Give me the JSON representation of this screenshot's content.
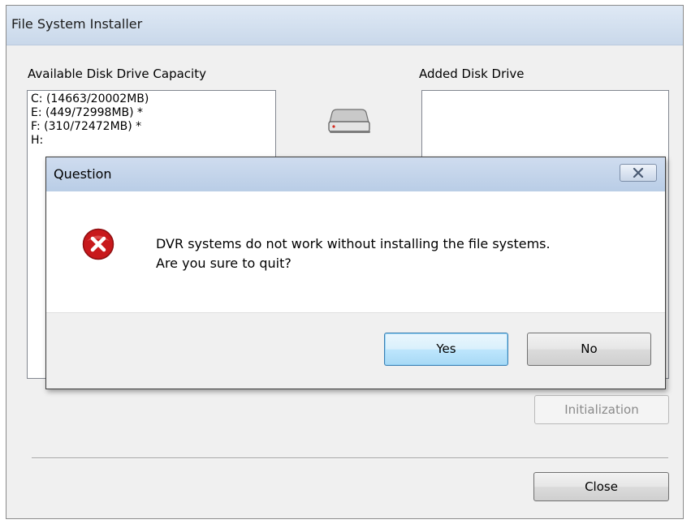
{
  "window": {
    "title": "File System Installer",
    "available_label": "Available Disk Drive Capacity",
    "added_label": "Added Disk Drive",
    "available_drives": [
      "C:  (14663/20002MB)",
      "E:  (449/72998MB) *",
      "F:  (310/72472MB) *",
      "H:"
    ],
    "added_drives": [],
    "initialization_label": "Initialization",
    "close_label": "Close"
  },
  "dialog": {
    "title": "Question",
    "message_line1": "DVR systems do not work without installing the file systems.",
    "message_line2": "Are you sure to quit?",
    "yes_label": "Yes",
    "no_label": "No"
  },
  "icons": {
    "drive": "hard-drive-icon",
    "error": "error-icon",
    "close": "close-icon"
  },
  "colors": {
    "error_red": "#c8191c",
    "default_button_border": "#3c7fb1"
  }
}
